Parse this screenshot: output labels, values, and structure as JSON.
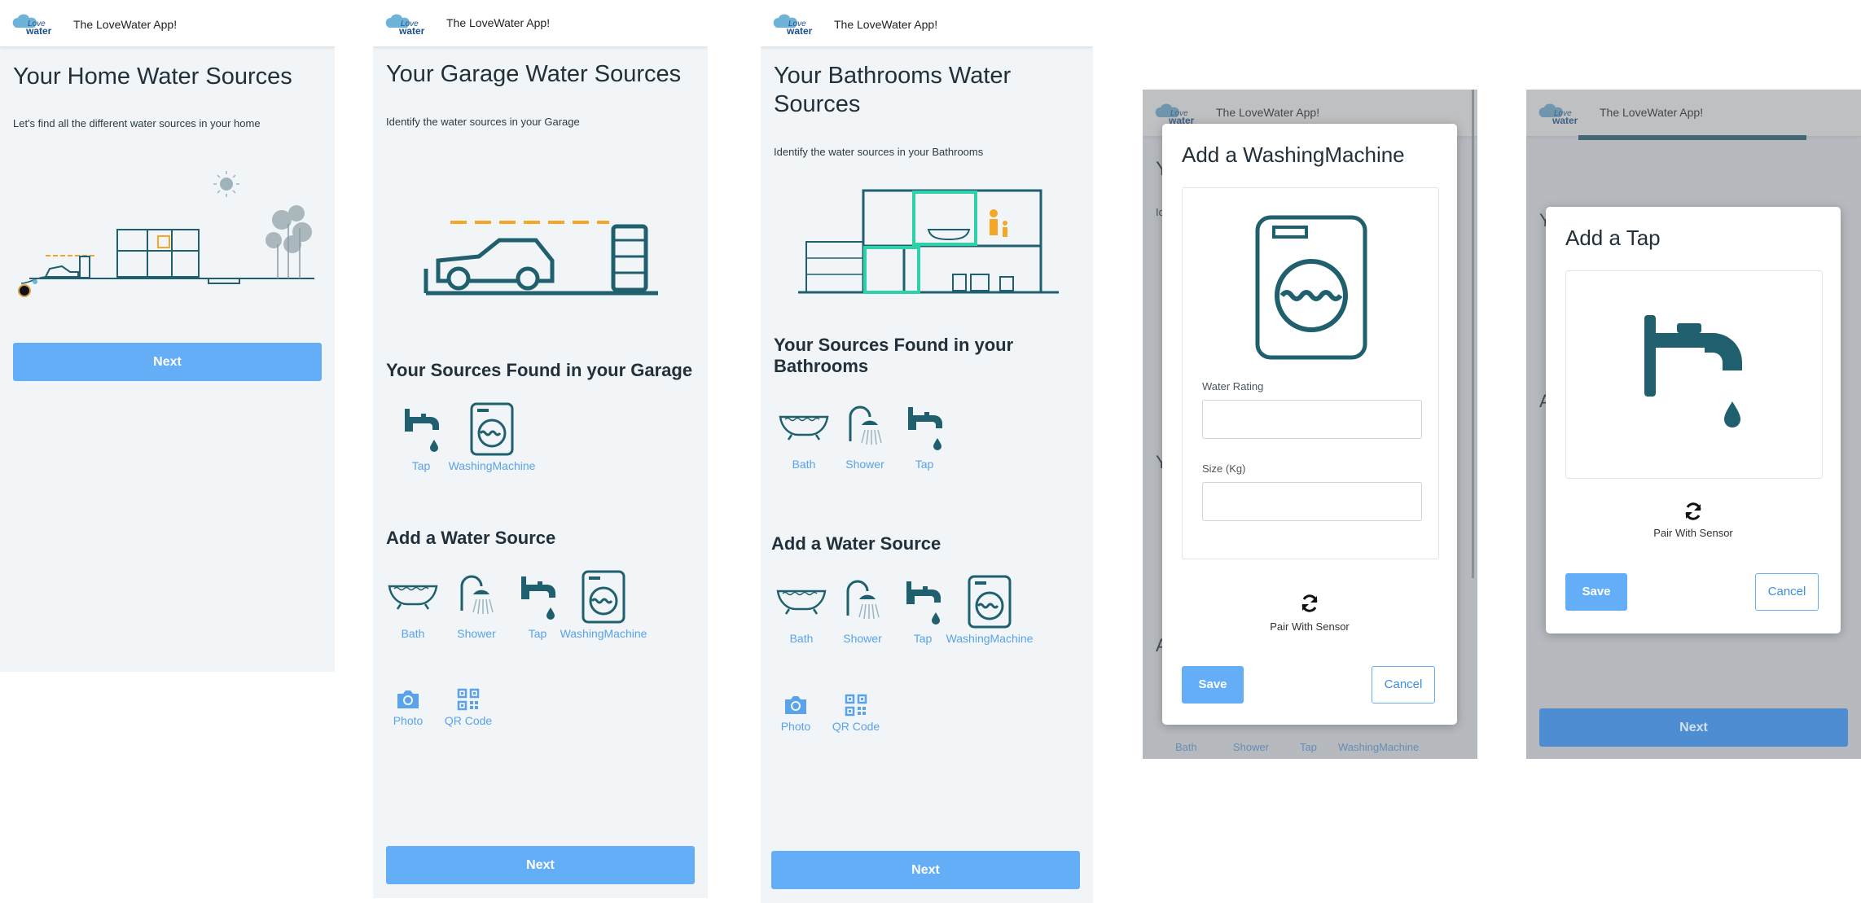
{
  "app": {
    "title": "The LoveWater App!",
    "logo_text": "Love water"
  },
  "screen1": {
    "title": "Your Home Water Sources",
    "subtitle": "Let's find all the different water sources in your home",
    "next_label": "Next"
  },
  "screen2": {
    "title": "Your Garage Water Sources",
    "subtitle": "Identify the water sources in your Garage",
    "found_heading": "Your Sources Found in your Garage",
    "found": [
      {
        "label": "Tap"
      },
      {
        "label": "WashingMachine"
      }
    ],
    "add_heading": "Add a Water Source",
    "add": [
      {
        "label": "Bath"
      },
      {
        "label": "Shower"
      },
      {
        "label": "Tap"
      },
      {
        "label": "WashingMachine"
      }
    ],
    "extra": [
      {
        "label": "Photo"
      },
      {
        "label": "QR Code"
      }
    ],
    "next_label": "Next"
  },
  "screen3": {
    "title_line1": "Your Bathrooms Water",
    "title_line2": "Sources",
    "subtitle": "Identify the water sources in your Bathrooms",
    "found_heading_line1": "Your Sources Found in your",
    "found_heading_line2": "Bathrooms",
    "found": [
      {
        "label": "Bath"
      },
      {
        "label": "Shower"
      },
      {
        "label": "Tap"
      }
    ],
    "add_heading": "Add a Water Source",
    "add": [
      {
        "label": "Bath"
      },
      {
        "label": "Shower"
      },
      {
        "label": "Tap"
      },
      {
        "label": "WashingMachine"
      }
    ],
    "extra": [
      {
        "label": "Photo"
      },
      {
        "label": "QR Code"
      }
    ],
    "next_label": "Next"
  },
  "screen4": {
    "bg_letters": [
      "Y",
      "Id",
      "Y",
      "A"
    ],
    "bg_labels": [
      "Bath",
      "Shower",
      "Tap",
      "WashingMachine"
    ],
    "modal": {
      "title": "Add a WashingMachine",
      "water_rating_label": "Water Rating",
      "water_rating_value": "",
      "size_label": "Size (Kg)",
      "size_value": "",
      "pair_label": "Pair With Sensor",
      "save_label": "Save",
      "cancel_label": "Cancel"
    }
  },
  "screen5": {
    "bg_letters": [
      "Y",
      "A"
    ],
    "modal": {
      "title": "Add a Tap",
      "pair_label": "Pair With Sensor",
      "save_label": "Save",
      "cancel_label": "Cancel"
    },
    "next_label": "Next"
  },
  "colors": {
    "primary": "#64aef8",
    "icon": "#1f5f6e",
    "accent": "#2ed1a8",
    "orange": "#f5a623"
  }
}
